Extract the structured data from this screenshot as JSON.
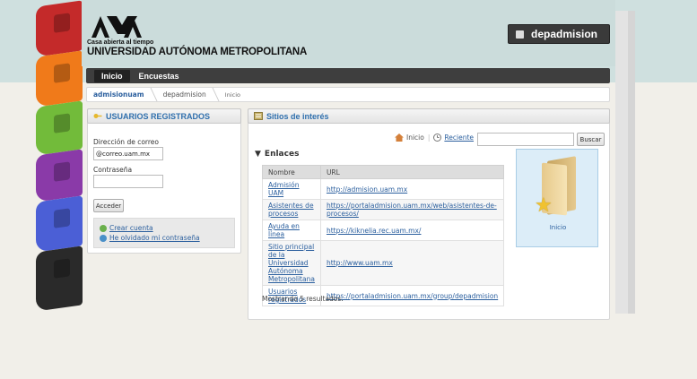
{
  "header": {
    "tagline": "Casa abierta al tiempo",
    "university": "UNIVERSIDAD AUTÓNOMA METROPOLITANA",
    "site_button": "depadmision"
  },
  "nav": {
    "tabs": [
      {
        "label": "Inicio",
        "active": true
      },
      {
        "label": "Encuestas",
        "active": false
      }
    ]
  },
  "breadcrumb": [
    "admisionuam",
    "depadmision",
    "Inicio"
  ],
  "login": {
    "title": "USUARIOS REGISTRADOS",
    "email_label": "Dirección de correo",
    "email_value": "@correo.uam.mx",
    "password_label": "Contraseña",
    "submit_label": "Acceder",
    "create_account": "Crear cuenta",
    "forgot_password": "He olvidado mi contraseña"
  },
  "sites": {
    "title": "Sitios de interés",
    "home_link": "Inicio",
    "recent_link": "Reciente",
    "search_button": "Buscar",
    "section": "Enlaces",
    "columns": [
      "Nombre",
      "URL"
    ],
    "rows": [
      {
        "name": "Admisión UAM",
        "url": "http://admision.uam.mx"
      },
      {
        "name": "Asistentes de procesos",
        "url": "https://portaladmision.uam.mx/web/asistentes-de-procesos/"
      },
      {
        "name": "Ayuda en línea",
        "url": "https://kiknelia.rec.uam.mx/"
      },
      {
        "name": "Sitio principal de la Universidad Autónoma Metropolitana",
        "url": "http://www.uam.mx"
      },
      {
        "name": "Usuarios registrados",
        "url": "https://portaladmision.uam.mx/group/depadmision"
      }
    ],
    "results": "Mostrando 5 resultados.",
    "folder_label": "Inicio"
  },
  "colors": {
    "header_bg": "#cbdcdb",
    "nav_bg": "#3e3e3e",
    "link": "#2b5f9e",
    "deco": [
      "#c02828",
      "#f07a1a",
      "#7cc242",
      "#8a3aa8",
      "#4b5fd6",
      "#2a2a2a"
    ]
  }
}
